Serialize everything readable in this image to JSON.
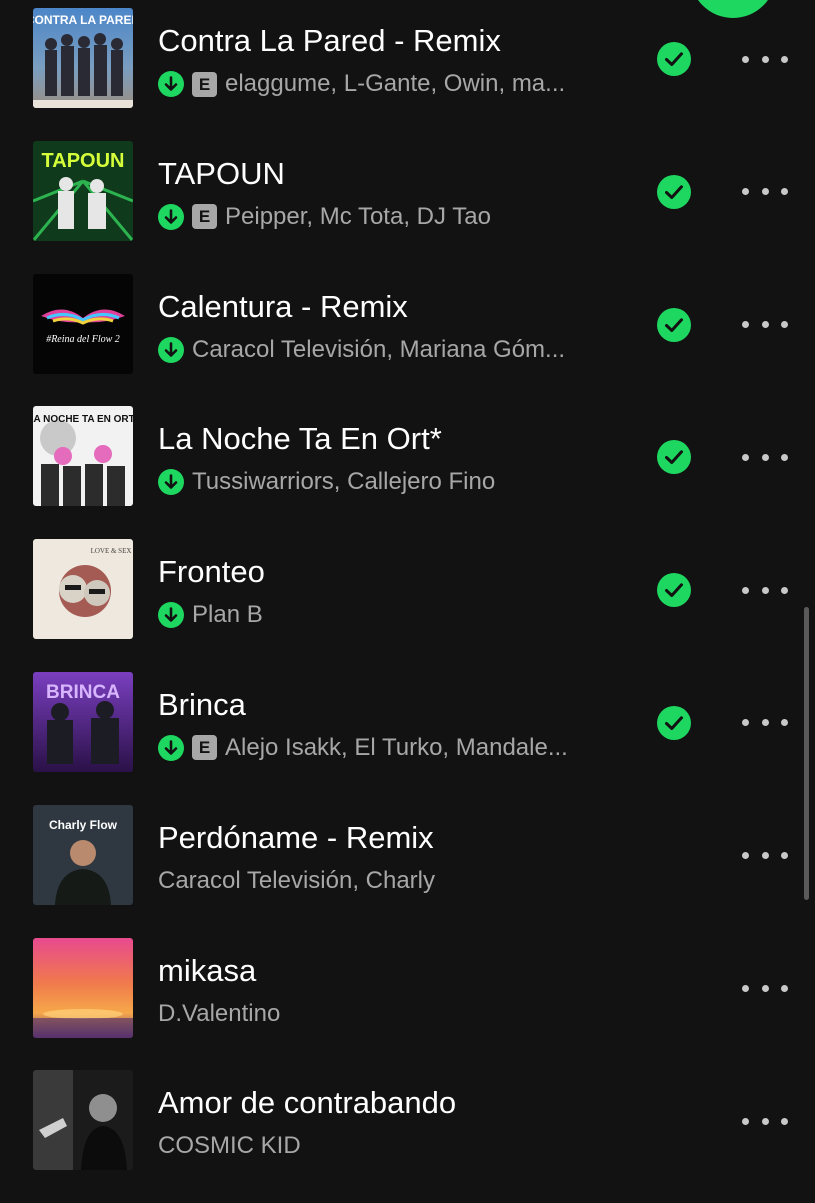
{
  "colors": {
    "background": "#121212",
    "accent_green": "#1ed760",
    "secondary_text": "#a7a7a7"
  },
  "tracks": [
    {
      "title": "Contra La Pared - Remix",
      "artists": "elaggume, L-Gante, Owin, ma...",
      "downloaded": true,
      "explicit": true,
      "saved": true,
      "explicit_label": "E",
      "cover_text": "CONTRA LA PARED"
    },
    {
      "title": "TAPOUN",
      "artists": "Peipper, Mc Tota, DJ Tao",
      "downloaded": true,
      "explicit": true,
      "saved": true,
      "explicit_label": "E",
      "cover_text": "TAPOUN"
    },
    {
      "title": "Calentura - Remix",
      "artists": "Caracol Televisión, Mariana Góm...",
      "downloaded": true,
      "explicit": false,
      "saved": true,
      "cover_text": "#Reina del Flow 2"
    },
    {
      "title": "La Noche Ta En Ort*",
      "artists": "Tussiwarriors, Callejero Fino",
      "downloaded": true,
      "explicit": false,
      "saved": true,
      "cover_text": "LA NOCHE TA EN ORT*"
    },
    {
      "title": "Fronteo",
      "artists": "Plan B",
      "downloaded": true,
      "explicit": false,
      "saved": true,
      "cover_text": "LOVE & SEX"
    },
    {
      "title": "Brinca",
      "artists": "Alejo Isakk, El Turko, Mandale...",
      "downloaded": true,
      "explicit": true,
      "saved": true,
      "explicit_label": "E",
      "cover_text": "BRINCA"
    },
    {
      "title": "Perdóname - Remix",
      "artists": "Caracol Televisión, Charly",
      "downloaded": false,
      "explicit": false,
      "saved": false,
      "cover_text": "Charly Flow"
    },
    {
      "title": "mikasa",
      "artists": "D.Valentino",
      "downloaded": false,
      "explicit": false,
      "saved": false,
      "cover_text": ""
    },
    {
      "title": "Amor de contrabando",
      "artists": "COSMIC KID",
      "downloaded": false,
      "explicit": false,
      "saved": false,
      "cover_text": ""
    }
  ]
}
